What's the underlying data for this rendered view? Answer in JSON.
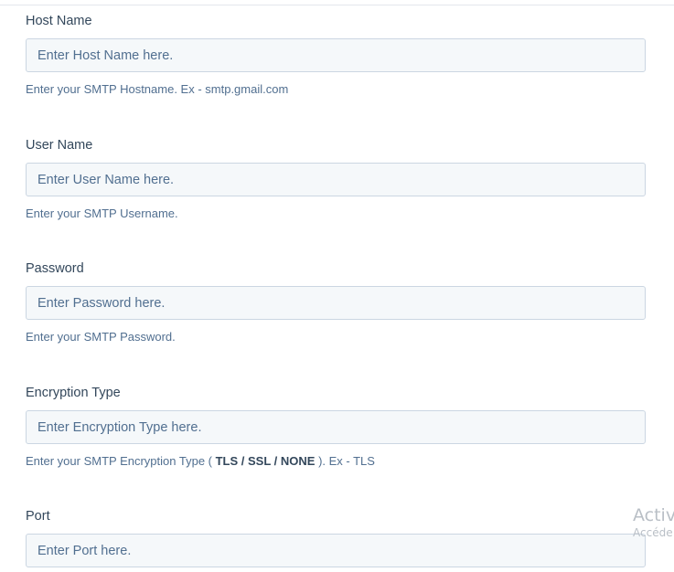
{
  "fields": [
    {
      "id": "host_name",
      "label": "Host Name",
      "value": "",
      "placeholder": "Enter Host Name here.",
      "help": "Enter your SMTP Hostname. Ex - smtp.gmail.com"
    },
    {
      "id": "user_name",
      "label": "User Name",
      "value": "",
      "placeholder": "Enter User Name here.",
      "help": "Enter your SMTP Username."
    },
    {
      "id": "password",
      "label": "Password",
      "value": "",
      "placeholder": "Enter Password here.",
      "help": "Enter your SMTP Password."
    },
    {
      "id": "encryption_type",
      "label": "Encryption Type",
      "value": "",
      "placeholder": "Enter Encryption Type here.",
      "help_prefix": "Enter your SMTP Encryption Type ( ",
      "help_bold": "TLS / SSL / NONE",
      "help_suffix": " ). Ex - TLS"
    },
    {
      "id": "port",
      "label": "Port",
      "value": "",
      "placeholder": "Enter Port here."
    }
  ],
  "watermark": {
    "line1": "Activ",
    "line2": "Accéde"
  },
  "colors": {
    "label": "#33475b",
    "help": "#516f90",
    "input_bg": "#f5f8fa",
    "input_border": "#cbd6e2",
    "watermark": "#b9bfc6"
  }
}
